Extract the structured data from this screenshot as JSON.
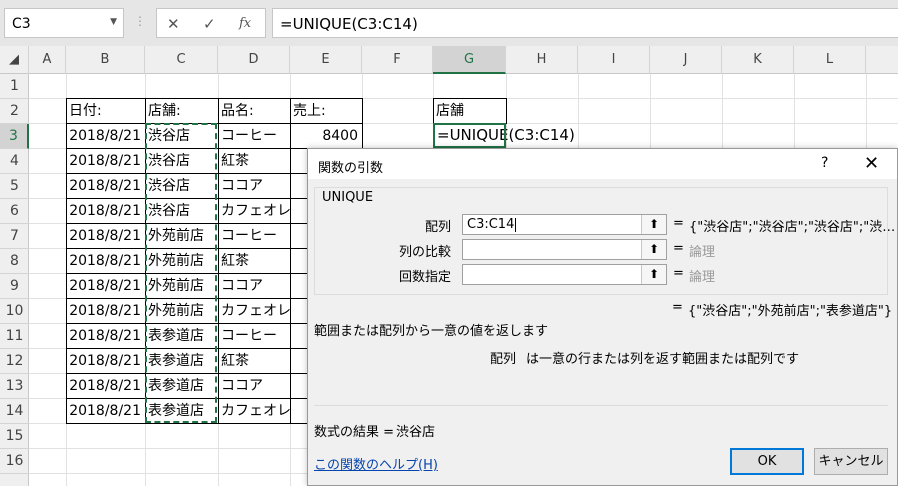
{
  "formula_bar": {
    "name_box": "C3",
    "cancel_icon": "✕",
    "enter_icon": "✓",
    "fx_icon": "fx",
    "formula": "=UNIQUE(C3:C14)"
  },
  "columns": [
    "A",
    "B",
    "C",
    "D",
    "E",
    "F",
    "G",
    "H",
    "I",
    "J",
    "K",
    "L"
  ],
  "rows": [
    "1",
    "2",
    "3",
    "4",
    "5",
    "6",
    "7",
    "8",
    "9",
    "10",
    "11",
    "12",
    "13",
    "14",
    "15",
    "16"
  ],
  "table": {
    "headers": [
      "日付:",
      "店舗:",
      "品名:",
      "売上:"
    ],
    "rows": [
      [
        "2018/8/21",
        "渋谷店",
        "コーヒー",
        "8400"
      ],
      [
        "2018/8/21",
        "渋谷店",
        "紅茶",
        ""
      ],
      [
        "2018/8/21",
        "渋谷店",
        "ココア",
        ""
      ],
      [
        "2018/8/21",
        "渋谷店",
        "カフェオレ",
        ""
      ],
      [
        "2018/8/21",
        "外苑前店",
        "コーヒー",
        ""
      ],
      [
        "2018/8/21",
        "外苑前店",
        "紅茶",
        ""
      ],
      [
        "2018/8/21",
        "外苑前店",
        "ココア",
        ""
      ],
      [
        "2018/8/21",
        "外苑前店",
        "カフェオレ",
        ""
      ],
      [
        "2018/8/21",
        "表参道店",
        "コーヒー",
        ""
      ],
      [
        "2018/8/21",
        "表参道店",
        "紅茶",
        ""
      ],
      [
        "2018/8/21",
        "表参道店",
        "ココア",
        ""
      ],
      [
        "2018/8/21",
        "表参道店",
        "カフェオレ",
        ""
      ]
    ]
  },
  "g_column": {
    "header": "店舗",
    "edit_formula": "=UNIQUE(C3:C14)"
  },
  "dialog": {
    "title": "関数の引数",
    "help_glyph": "?",
    "close_glyph": "✕",
    "function_name": "UNIQUE",
    "args": [
      {
        "label": "配列",
        "value": "C3:C14",
        "result": "{\"渋谷店\";\"渋谷店\";\"渋谷店\";\"渋…"
      },
      {
        "label": "列の比較",
        "value": "",
        "result": "論理"
      },
      {
        "label": "回数指定",
        "value": "",
        "result": "論理"
      }
    ],
    "eq": "=",
    "function_result": "{\"渋谷店\";\"外苑前店\";\"表参道店\"}",
    "description": "範囲または配列から一意の値を返します",
    "arg_description_name": "配列",
    "arg_description": "は一意の行または列を返す範囲または配列です",
    "formula_result_label": "数式の結果 =",
    "formula_result_value": "渋谷店",
    "help_link": "この関数のヘルプ(H)",
    "ok": "OK",
    "cancel": "キャンセル"
  },
  "colors": {
    "accent": "#217346",
    "link": "#0645ad",
    "focus": "#0078d7"
  }
}
